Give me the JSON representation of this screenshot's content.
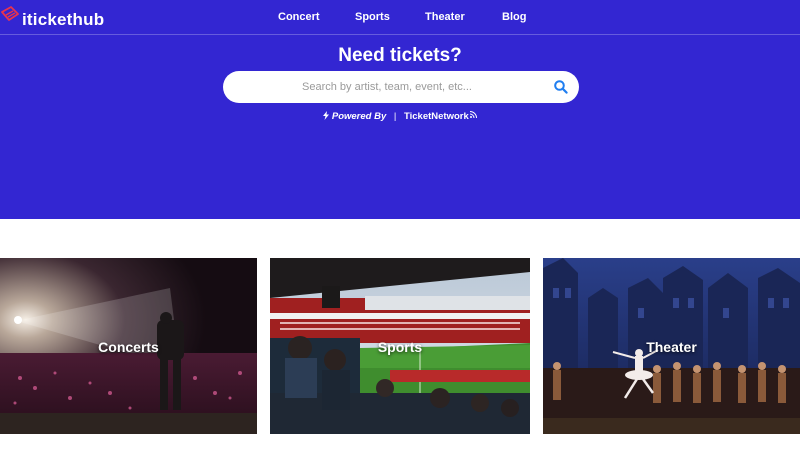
{
  "brand": {
    "name": "iticketHub",
    "display": "itickethub"
  },
  "nav": {
    "items": [
      {
        "label": "Concert"
      },
      {
        "label": "Sports"
      },
      {
        "label": "Theater"
      },
      {
        "label": "Blog"
      }
    ]
  },
  "hero": {
    "headline": "Need tickets?",
    "search": {
      "placeholder": "Search by artist, team, event, etc...",
      "value": ""
    },
    "powered": {
      "prefix": "Powered By",
      "separator": "|",
      "partner": "TicketNetwork"
    }
  },
  "categories": [
    {
      "label": "Concerts"
    },
    {
      "label": "Sports"
    },
    {
      "label": "Theater"
    }
  ],
  "colors": {
    "hero_bg": "#3326d2",
    "logo_accent": "#e8344e",
    "search_icon": "#1f7ef0"
  },
  "icons": {
    "logo": "ticket-logo-icon",
    "search": "search-icon",
    "bolt": "bolt-icon",
    "rss": "rss-icon"
  }
}
